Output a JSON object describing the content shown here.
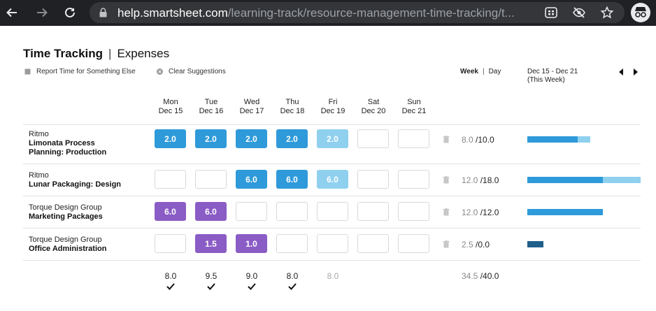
{
  "browser": {
    "url_host": "help.smartsheet.com",
    "url_path": "/learning-track/resource-management-time-tracking/t..."
  },
  "header": {
    "title": "Time Tracking",
    "separator": "|",
    "subtitle": "Expenses"
  },
  "actions": {
    "report_time": "Report Time for Something Else",
    "clear_suggestions": "Clear Suggestions"
  },
  "view_toggle": {
    "week": "Week",
    "separator": "|",
    "day": "Day"
  },
  "date_range": {
    "range": "Dec 15 - Dec 21",
    "note": "(This Week)"
  },
  "days": [
    {
      "dow": "Mon",
      "date": "Dec 15",
      "total": "8.0"
    },
    {
      "dow": "Tue",
      "date": "Dec 16",
      "total": "9.5"
    },
    {
      "dow": "Wed",
      "date": "Dec 17",
      "total": "9.0"
    },
    {
      "dow": "Thu",
      "date": "Dec 18",
      "total": "8.0"
    },
    {
      "dow": "Fri",
      "date": "Dec 19",
      "total": "8.0"
    },
    {
      "dow": "Sat",
      "date": "Dec 20",
      "total": ""
    },
    {
      "dow": "Sun",
      "date": "Dec 21",
      "total": ""
    }
  ],
  "rows": [
    {
      "client": "Ritmo",
      "task": "Limonata Process Planning: Production",
      "task_line1": "Limonata Process",
      "task_line2": "Planning: Production",
      "cells": [
        "2.0",
        "2.0",
        "2.0",
        "2.0",
        "2.0",
        "",
        ""
      ],
      "cell_styles": [
        "blue",
        "blue",
        "blue",
        "blue",
        "lightblue",
        "empty",
        "empty"
      ],
      "logged": "8.0",
      "capacity": "/10.0",
      "bar": {
        "scale_max": 18,
        "actual": 8.0,
        "planned": 10.0,
        "color": "#2e9ad9",
        "planned_color": "#8fd0ef"
      }
    },
    {
      "client": "Ritmo",
      "task": "Lunar Packaging: Design",
      "cells": [
        "",
        "",
        "6.0",
        "6.0",
        "6.0",
        "",
        ""
      ],
      "cell_styles": [
        "empty",
        "empty",
        "blue",
        "blue",
        "lightblue",
        "empty",
        "empty"
      ],
      "logged": "12.0",
      "capacity": "/18.0",
      "bar": {
        "scale_max": 18,
        "actual": 12.0,
        "planned": 18.0,
        "color": "#2e9ad9",
        "planned_color": "#8fd0ef"
      }
    },
    {
      "client": "Torque Design Group",
      "task": "Marketing Packages",
      "cells": [
        "6.0",
        "6.0",
        "",
        "",
        "",
        "",
        ""
      ],
      "cell_styles": [
        "purple",
        "purple",
        "empty",
        "empty",
        "empty",
        "empty",
        "empty"
      ],
      "logged": "12.0",
      "capacity": "/12.0",
      "bar": {
        "scale_max": 18,
        "actual": 12.0,
        "planned": 12.0,
        "color": "#2e9ad9",
        "planned_color": "#8fd0ef"
      }
    },
    {
      "client": "Torque Design Group",
      "task": "Office Administration",
      "cells": [
        "",
        "1.5",
        "1.0",
        "",
        "",
        "",
        ""
      ],
      "cell_styles": [
        "empty",
        "purple",
        "purple",
        "empty",
        "empty",
        "empty",
        "empty"
      ],
      "logged": "2.5",
      "capacity": "/0.0",
      "bar": {
        "scale_max": 18,
        "actual": 2.5,
        "planned": 0.0,
        "color": "#1f5f8b",
        "planned_color": "#8fd0ef"
      }
    }
  ],
  "totals": {
    "logged": "34.5",
    "capacity": "/40.0"
  },
  "colors": {
    "blue": "#2e9ad9",
    "light_blue": "#8fd0ef",
    "purple": "#8a5cc5",
    "dark_blue": "#1f5f8b"
  }
}
